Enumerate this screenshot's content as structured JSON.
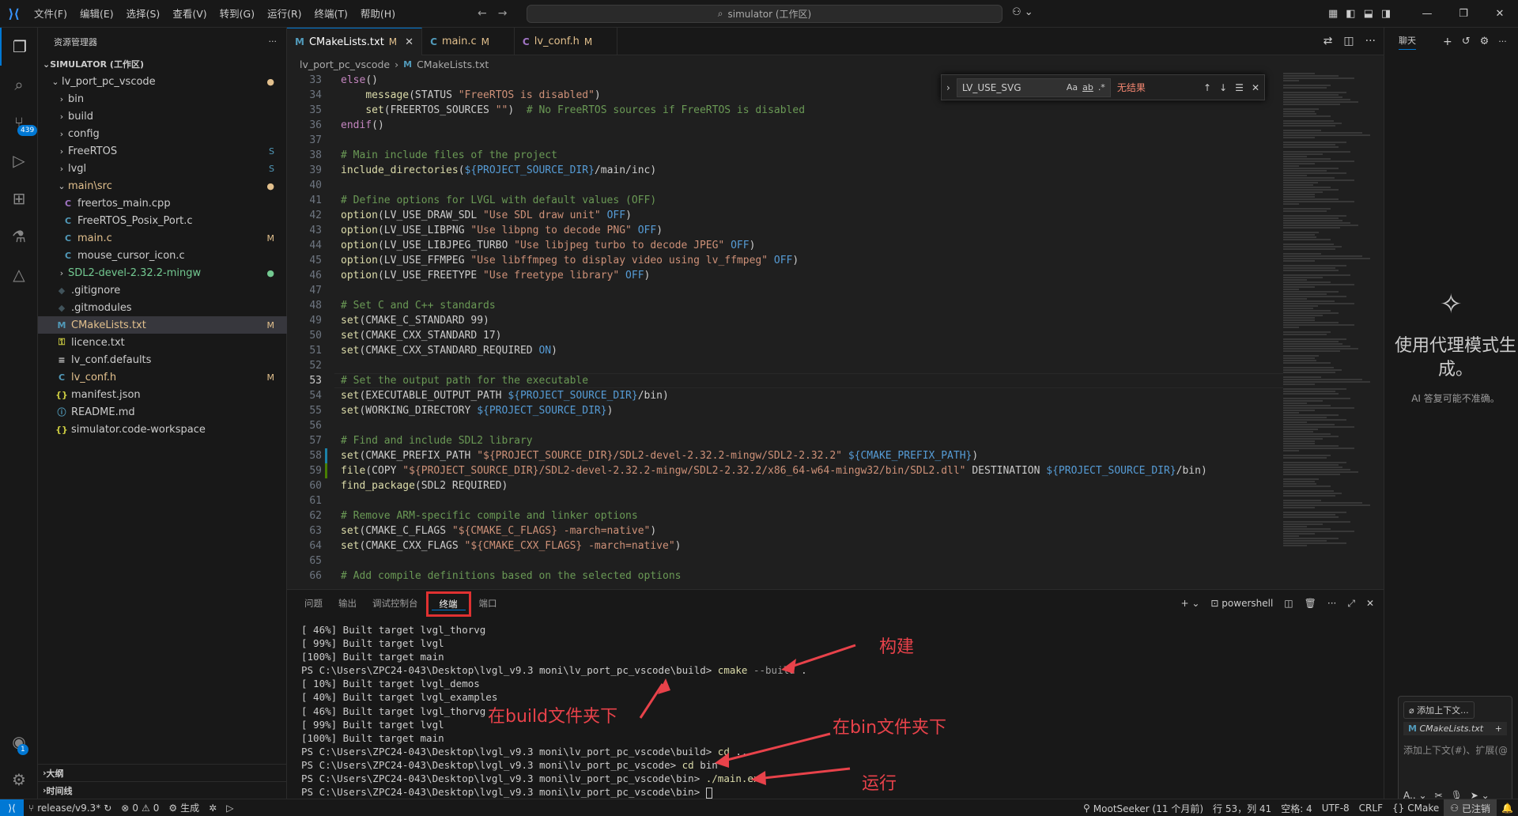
{
  "titlebar": {
    "menus": [
      "文件(F)",
      "编辑(E)",
      "选择(S)",
      "查看(V)",
      "转到(G)",
      "运行(R)",
      "终端(T)",
      "帮助(H)"
    ],
    "search_text": "simulator (工作区)"
  },
  "activity": {
    "scm_badge": "439",
    "account_badge": "1"
  },
  "sidebar": {
    "title": "资源管理器",
    "workspace": "SIMULATOR (工作区)",
    "tree": [
      {
        "label": "lv_port_pc_vscode",
        "depth": 1,
        "kind": "folder-open",
        "deco": "●",
        "deco_class": "c-mod",
        "label_class": ""
      },
      {
        "label": "bin",
        "depth": 2,
        "kind": "folder",
        "deco": "",
        "deco_class": "",
        "label_class": ""
      },
      {
        "label": "build",
        "depth": 2,
        "kind": "folder",
        "deco": "",
        "deco_class": "",
        "label_class": ""
      },
      {
        "label": "config",
        "depth": 2,
        "kind": "folder",
        "deco": "",
        "deco_class": "",
        "label_class": ""
      },
      {
        "label": "FreeRTOS",
        "depth": 2,
        "kind": "folder",
        "deco": "S",
        "deco_class": "c-icon-c",
        "label_class": "c-icon-c"
      },
      {
        "label": "lvgl",
        "depth": 2,
        "kind": "folder",
        "deco": "S",
        "deco_class": "c-icon-c",
        "label_class": "c-icon-c"
      },
      {
        "label": "main\\src",
        "depth": 2,
        "kind": "folder-open",
        "deco": "●",
        "deco_class": "c-mod",
        "label_class": "c-mod"
      },
      {
        "label": "freertos_main.cpp",
        "depth": 3,
        "kind": "cpp",
        "deco": "",
        "deco_class": "",
        "label_class": ""
      },
      {
        "label": "FreeRTOS_Posix_Port.c",
        "depth": 3,
        "kind": "c",
        "deco": "",
        "deco_class": "",
        "label_class": ""
      },
      {
        "label": "main.c",
        "depth": 3,
        "kind": "c",
        "deco": "M",
        "deco_class": "c-mod",
        "label_class": "c-mod"
      },
      {
        "label": "mouse_cursor_icon.c",
        "depth": 3,
        "kind": "c",
        "deco": "",
        "deco_class": "",
        "label_class": ""
      },
      {
        "label": "SDL2-devel-2.32.2-mingw",
        "depth": 2,
        "kind": "folder",
        "deco": "●",
        "deco_class": "c-untr",
        "label_class": "c-untr"
      },
      {
        "label": ".gitignore",
        "depth": 2,
        "kind": "git",
        "deco": "",
        "deco_class": "",
        "label_class": ""
      },
      {
        "label": ".gitmodules",
        "depth": 2,
        "kind": "git",
        "deco": "",
        "deco_class": "",
        "label_class": ""
      },
      {
        "label": "CMakeLists.txt",
        "depth": 2,
        "kind": "m",
        "deco": "M",
        "deco_class": "c-mod",
        "label_class": "c-mod",
        "selected": true
      },
      {
        "label": "licence.txt",
        "depth": 2,
        "kind": "lic",
        "deco": "",
        "deco_class": "",
        "label_class": ""
      },
      {
        "label": "lv_conf.defaults",
        "depth": 2,
        "kind": "txt",
        "deco": "",
        "deco_class": "",
        "label_class": ""
      },
      {
        "label": "lv_conf.h",
        "depth": 2,
        "kind": "c",
        "deco": "M",
        "deco_class": "c-mod",
        "label_class": "c-mod"
      },
      {
        "label": "manifest.json",
        "depth": 2,
        "kind": "json",
        "deco": "",
        "deco_class": "",
        "label_class": ""
      },
      {
        "label": "README.md",
        "depth": 2,
        "kind": "md",
        "deco": "",
        "deco_class": "",
        "label_class": ""
      },
      {
        "label": "simulator.code-workspace",
        "depth": 2,
        "kind": "json",
        "deco": "",
        "deco_class": "",
        "label_class": ""
      }
    ],
    "outline": "大纲",
    "timeline": "时间线"
  },
  "tabs": [
    {
      "icon": "M",
      "label": "CMakeLists.txt",
      "mod": "M",
      "active": true
    },
    {
      "icon": "C",
      "label": "main.c",
      "mod": "M",
      "active": false
    },
    {
      "icon": "C",
      "label": "lv_conf.h",
      "mod": "M",
      "active": false
    }
  ],
  "breadcrumb": {
    "folder": "lv_port_pc_vscode",
    "file": "CMakeLists.txt"
  },
  "find": {
    "query": "LV_USE_SVG",
    "result": "无结果",
    "opt_case": "Aa",
    "opt_word": "ab",
    "opt_regex": ".*"
  },
  "code": [
    {
      "n": 33,
      "g": "",
      "t": [
        [
          "kw",
          "else"
        ],
        [
          "plain",
          "()"
        ]
      ]
    },
    {
      "n": 34,
      "g": "",
      "t": [
        [
          "plain",
          "    "
        ],
        [
          "fn",
          "message"
        ],
        [
          "plain",
          "(STATUS "
        ],
        [
          "str",
          "\"FreeRTOS is disabled\""
        ],
        [
          "plain",
          ")"
        ]
      ]
    },
    {
      "n": 35,
      "g": "",
      "t": [
        [
          "plain",
          "    "
        ],
        [
          "fn",
          "set"
        ],
        [
          "plain",
          "(FREERTOS_SOURCES "
        ],
        [
          "str",
          "\"\""
        ],
        [
          "plain",
          ")  "
        ],
        [
          "com",
          "# No FreeRTOS sources if FreeRTOS is disabled"
        ]
      ]
    },
    {
      "n": 36,
      "g": "",
      "t": [
        [
          "kw",
          "endif"
        ],
        [
          "plain",
          "()"
        ]
      ]
    },
    {
      "n": 37,
      "g": "",
      "t": []
    },
    {
      "n": 38,
      "g": "",
      "t": [
        [
          "com",
          "# Main include files of the project"
        ]
      ]
    },
    {
      "n": 39,
      "g": "",
      "t": [
        [
          "fn",
          "include_directories"
        ],
        [
          "plain",
          "("
        ],
        [
          "var",
          "${PROJECT_SOURCE_DIR}"
        ],
        [
          "plain",
          "/main/inc)"
        ]
      ]
    },
    {
      "n": 40,
      "g": "",
      "t": []
    },
    {
      "n": 41,
      "g": "",
      "t": [
        [
          "com",
          "# Define options for LVGL with default values (OFF)"
        ]
      ]
    },
    {
      "n": 42,
      "g": "",
      "t": [
        [
          "fn",
          "option"
        ],
        [
          "plain",
          "(LV_USE_DRAW_SDL "
        ],
        [
          "str",
          "\"Use SDL draw unit\""
        ],
        [
          "plain",
          " "
        ],
        [
          "var",
          "OFF"
        ],
        [
          "plain",
          ")"
        ]
      ]
    },
    {
      "n": 43,
      "g": "",
      "t": [
        [
          "fn",
          "option"
        ],
        [
          "plain",
          "(LV_USE_LIBPNG "
        ],
        [
          "str",
          "\"Use libpng to decode PNG\""
        ],
        [
          "plain",
          " "
        ],
        [
          "var",
          "OFF"
        ],
        [
          "plain",
          ")"
        ]
      ]
    },
    {
      "n": 44,
      "g": "",
      "t": [
        [
          "fn",
          "option"
        ],
        [
          "plain",
          "(LV_USE_LIBJPEG_TURBO "
        ],
        [
          "str",
          "\"Use libjpeg turbo to decode JPEG\""
        ],
        [
          "plain",
          " "
        ],
        [
          "var",
          "OFF"
        ],
        [
          "plain",
          ")"
        ]
      ]
    },
    {
      "n": 45,
      "g": "",
      "t": [
        [
          "fn",
          "option"
        ],
        [
          "plain",
          "(LV_USE_FFMPEG "
        ],
        [
          "str",
          "\"Use libffmpeg to display video using lv_ffmpeg\""
        ],
        [
          "plain",
          " "
        ],
        [
          "var",
          "OFF"
        ],
        [
          "plain",
          ")"
        ]
      ]
    },
    {
      "n": 46,
      "g": "",
      "t": [
        [
          "fn",
          "option"
        ],
        [
          "plain",
          "(LV_USE_FREETYPE "
        ],
        [
          "str",
          "\"Use freetype library\""
        ],
        [
          "plain",
          " "
        ],
        [
          "var",
          "OFF"
        ],
        [
          "plain",
          ")"
        ]
      ]
    },
    {
      "n": 47,
      "g": "",
      "t": []
    },
    {
      "n": 48,
      "g": "",
      "t": [
        [
          "com",
          "# Set C and C++ standards"
        ]
      ]
    },
    {
      "n": 49,
      "g": "",
      "t": [
        [
          "fn",
          "set"
        ],
        [
          "plain",
          "(CMAKE_C_STANDARD 99)"
        ]
      ]
    },
    {
      "n": 50,
      "g": "",
      "t": [
        [
          "fn",
          "set"
        ],
        [
          "plain",
          "(CMAKE_CXX_STANDARD 17)"
        ]
      ]
    },
    {
      "n": 51,
      "g": "",
      "t": [
        [
          "fn",
          "set"
        ],
        [
          "plain",
          "(CMAKE_CXX_STANDARD_REQUIRED "
        ],
        [
          "var",
          "ON"
        ],
        [
          "plain",
          ")"
        ]
      ]
    },
    {
      "n": 52,
      "g": "",
      "t": []
    },
    {
      "n": 53,
      "g": "",
      "cur": true,
      "t": [
        [
          "com",
          "# Set the output path for the executable"
        ]
      ]
    },
    {
      "n": 54,
      "g": "",
      "t": [
        [
          "fn",
          "set"
        ],
        [
          "plain",
          "(EXECUTABLE_OUTPUT_PATH "
        ],
        [
          "var",
          "${PROJECT_SOURCE_DIR}"
        ],
        [
          "plain",
          "/bin)"
        ]
      ]
    },
    {
      "n": 55,
      "g": "",
      "t": [
        [
          "fn",
          "set"
        ],
        [
          "plain",
          "(WORKING_DIRECTORY "
        ],
        [
          "var",
          "${PROJECT_SOURCE_DIR}"
        ],
        [
          "plain",
          ")"
        ]
      ]
    },
    {
      "n": 56,
      "g": "",
      "t": []
    },
    {
      "n": 57,
      "g": "",
      "t": [
        [
          "com",
          "# Find and include SDL2 library"
        ]
      ]
    },
    {
      "n": 58,
      "g": "mod",
      "t": [
        [
          "fn",
          "set"
        ],
        [
          "plain",
          "(CMAKE_PREFIX_PATH "
        ],
        [
          "str",
          "\"${PROJECT_SOURCE_DIR}/SDL2-devel-2.32.2-mingw/SDL2-2.32.2\""
        ],
        [
          "plain",
          " "
        ],
        [
          "var",
          "${CMAKE_PREFIX_PATH}"
        ],
        [
          "plain",
          ")"
        ]
      ]
    },
    {
      "n": 59,
      "g": "add",
      "t": [
        [
          "fn",
          "file"
        ],
        [
          "plain",
          "(COPY "
        ],
        [
          "str",
          "\"${PROJECT_SOURCE_DIR}/SDL2-devel-2.32.2-mingw/SDL2-2.32.2/x86_64-w64-mingw32/bin/SDL2.dll\""
        ],
        [
          "plain",
          " DESTINATION "
        ],
        [
          "var",
          "${PROJECT_SOURCE_DIR}"
        ],
        [
          "plain",
          "/bin)"
        ]
      ]
    },
    {
      "n": 60,
      "g": "",
      "t": [
        [
          "fn",
          "find_package"
        ],
        [
          "plain",
          "(SDL2 REQUIRED)"
        ]
      ]
    },
    {
      "n": 61,
      "g": "",
      "t": []
    },
    {
      "n": 62,
      "g": "",
      "t": [
        [
          "com",
          "# Remove ARM-specific compile and linker options"
        ]
      ]
    },
    {
      "n": 63,
      "g": "",
      "t": [
        [
          "fn",
          "set"
        ],
        [
          "plain",
          "(CMAKE_C_FLAGS "
        ],
        [
          "str",
          "\"${CMAKE_C_FLAGS} -march=native\""
        ],
        [
          "plain",
          ")"
        ]
      ]
    },
    {
      "n": 64,
      "g": "",
      "t": [
        [
          "fn",
          "set"
        ],
        [
          "plain",
          "(CMAKE_CXX_FLAGS "
        ],
        [
          "str",
          "\"${CMAKE_CXX_FLAGS} -march=native\""
        ],
        [
          "plain",
          ")"
        ]
      ]
    },
    {
      "n": 65,
      "g": "",
      "t": []
    },
    {
      "n": 66,
      "g": "",
      "t": [
        [
          "com",
          "# Add compile definitions based on the selected options"
        ]
      ]
    }
  ],
  "panel": {
    "tabs": [
      "问题",
      "输出",
      "调试控制台",
      "终端",
      "端口"
    ],
    "shell": "powershell"
  },
  "terminal": [
    [
      [
        "plain",
        "[ 46%] Built target lvgl_thorvg"
      ]
    ],
    [
      [
        "plain",
        "[ 99%] Built target lvgl"
      ]
    ],
    [
      [
        "plain",
        "[100%] Built target main"
      ]
    ],
    [
      [
        "plain",
        "PS C:\\Users\\ZPC24-043\\Desktop\\lvgl_v9.3 moni\\lv_port_pc_vscode\\build> "
      ],
      [
        "cmd",
        "cmake"
      ],
      [
        "param",
        " --build"
      ],
      [
        "plain",
        " ."
      ]
    ],
    [
      [
        "plain",
        "[ 10%] Built target lvgl_demos"
      ]
    ],
    [
      [
        "plain",
        "[ 40%] Built target lvgl_examples"
      ]
    ],
    [
      [
        "plain",
        "[ 46%] Built target lvgl_thorvg"
      ]
    ],
    [
      [
        "plain",
        "[ 99%] Built target lvgl"
      ]
    ],
    [
      [
        "plain",
        "[100%] Built target main"
      ]
    ],
    [
      [
        "plain",
        "PS C:\\Users\\ZPC24-043\\Desktop\\lvgl_v9.3 moni\\lv_port_pc_vscode\\build> "
      ],
      [
        "cmd",
        "cd"
      ],
      [
        "plain",
        " .."
      ]
    ],
    [
      [
        "plain",
        "PS C:\\Users\\ZPC24-043\\Desktop\\lvgl_v9.3 moni\\lv_port_pc_vscode> "
      ],
      [
        "cmd",
        "cd"
      ],
      [
        "plain",
        " bin"
      ]
    ],
    [
      [
        "plain",
        "PS C:\\Users\\ZPC24-043\\Desktop\\lvgl_v9.3 moni\\lv_port_pc_vscode\\bin> "
      ],
      [
        "cmd",
        "./main.exe"
      ]
    ],
    [
      [
        "plain",
        "PS C:\\Users\\ZPC24-043\\Desktop\\lvgl_v9.3 moni\\lv_port_pc_vscode\\bin> "
      ],
      [
        "cursor",
        ""
      ]
    ]
  ],
  "annotations": {
    "build": "构建",
    "in_build": "在build文件夹下",
    "in_bin": "在bin文件夹下",
    "run": "运行"
  },
  "chat": {
    "title": "聊天",
    "heading": "使用代理模式生成。",
    "sub": "AI 答复可能不准确。",
    "add_context": "添加上下文...",
    "file": "CMakeLists.txt",
    "placeholder": "添加上下文(#)、扩展(@"
  },
  "status": {
    "branch": "release/v9.3*",
    "errors": "0",
    "warnings": "0",
    "build": "生成",
    "blame": "MootSeeker (11 个月前)",
    "position": "行 53，列 41",
    "spaces": "空格: 4",
    "encoding": "UTF-8",
    "eol": "CRLF",
    "lang": "CMake",
    "signed": "已注销"
  }
}
